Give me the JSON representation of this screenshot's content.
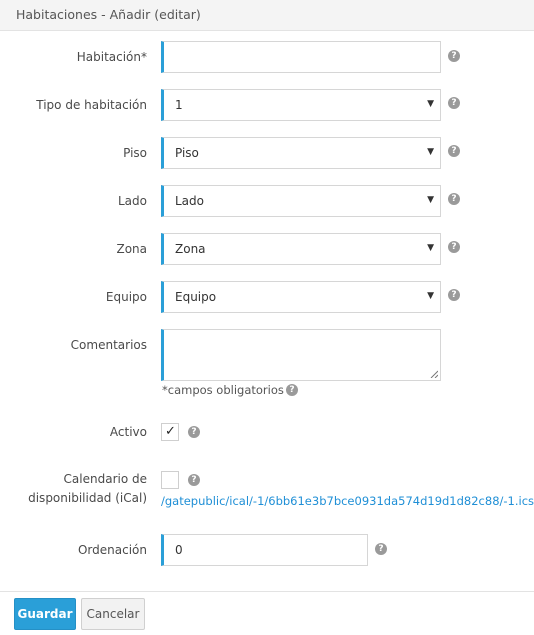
{
  "header": {
    "title": "Habitaciones - Añadir (editar)"
  },
  "form": {
    "habitacion": {
      "label": "Habitación*",
      "value": ""
    },
    "tipo": {
      "label": "Tipo de habitación",
      "value": "1"
    },
    "piso": {
      "label": "Piso",
      "value": "Piso"
    },
    "lado": {
      "label": "Lado",
      "value": "Lado"
    },
    "zona": {
      "label": "Zona",
      "value": "Zona"
    },
    "equipo": {
      "label": "Equipo",
      "value": "Equipo"
    },
    "comentarios": {
      "label": "Comentarios",
      "value": ""
    },
    "required_note": "*campos obligatorios",
    "activo": {
      "label": "Activo",
      "checked": true
    },
    "calendario": {
      "label_line1": "Calendario de",
      "label_line2": "disponibilidad (iCal)",
      "checked": false,
      "url": "/gatepublic/ical/-1/6bb61e3b7bce0931da574d19d1d82c88/-1.ics"
    },
    "ordenacion": {
      "label": "Ordenación",
      "value": "0"
    }
  },
  "buttons": {
    "save": "Guardar",
    "cancel": "Cancelar"
  },
  "icons": {
    "help": "question-circle-icon",
    "dropdown": "caret-down-icon",
    "check": "checkmark-icon"
  },
  "colors": {
    "accent": "#2a9fd8",
    "link": "#1f8fd6"
  }
}
